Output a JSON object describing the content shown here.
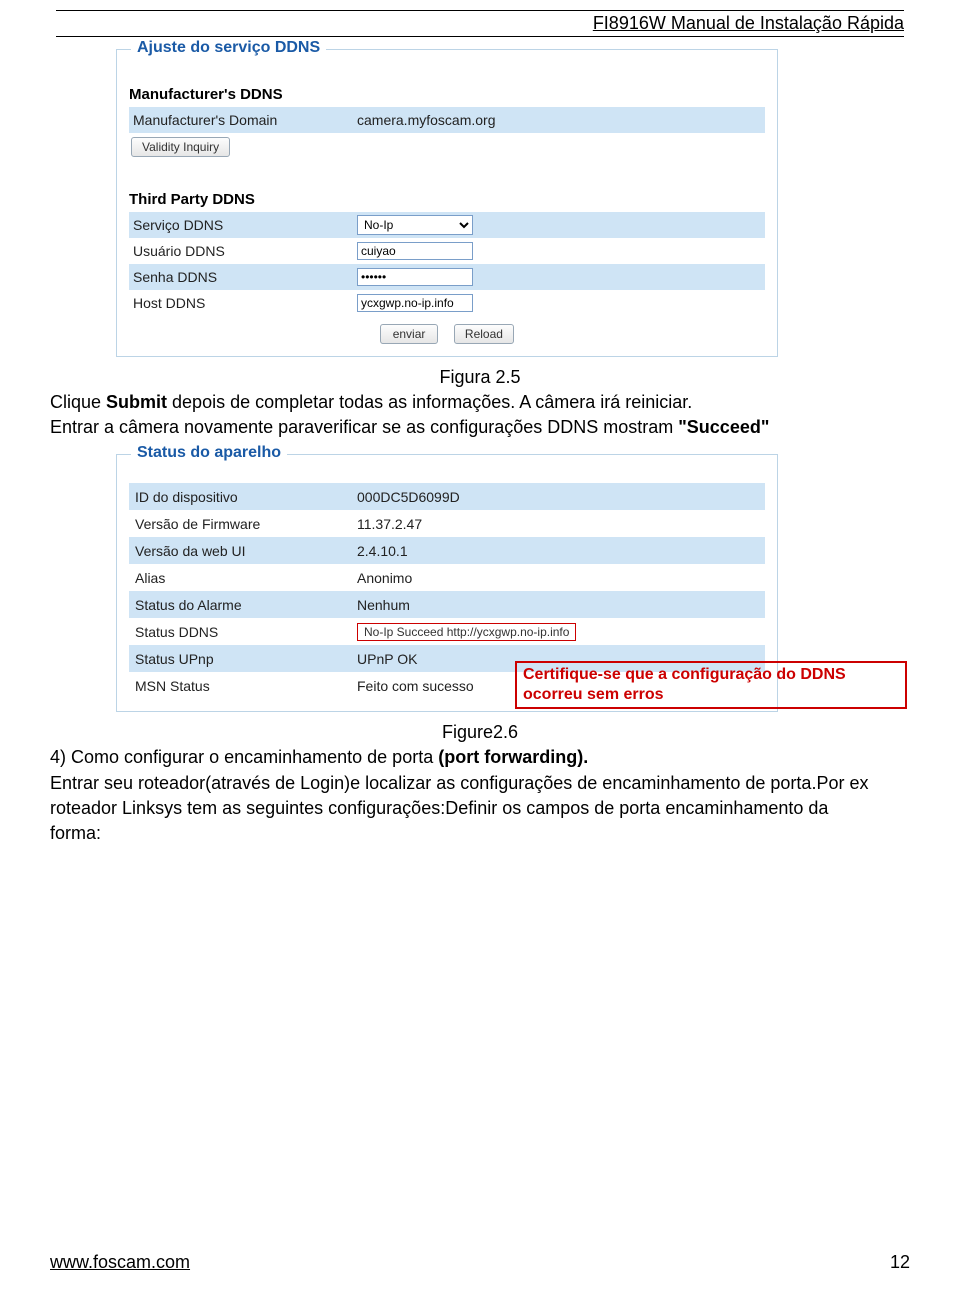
{
  "header": {
    "title": "FI8916W Manual de Instalação Rápida"
  },
  "panel1": {
    "title": "Ajuste do serviço DDNS",
    "manu_head": "Manufacturer's DDNS",
    "manu_domain_label": "Manufacturer's Domain",
    "manu_domain_value": "camera.myfoscam.org",
    "validity_btn": "Validity Inquiry",
    "third_head": "Third Party DDNS",
    "rows": {
      "servico_label": "Serviço DDNS",
      "servico_value": "No-Ip",
      "usuario_label": "Usuário DDNS",
      "usuario_value": "cuiyao",
      "senha_label": "Senha DDNS",
      "senha_value": "••••••",
      "host_label": "Host DDNS",
      "host_value": "ycxgwp.no-ip.info"
    },
    "buttons": {
      "enviar": "enviar",
      "reload": "Reload"
    }
  },
  "fig25": "Figura 2.5",
  "para1_a": "Clique ",
  "para1_b": "Submit",
  "para1_c": " depois de completar todas as informações. A câmera irá reiniciar.",
  "para2_a": "Entrar a câmera novamente paraverificar se as configurações DDNS mostram ",
  "para2_b": "\"Succeed\"",
  "panel2": {
    "title": "Status do aparelho",
    "rows": [
      {
        "label": "ID do dispositivo",
        "value": "000DC5D6099D",
        "shade": true
      },
      {
        "label": "Versão de Firmware",
        "value": "11.37.2.47",
        "shade": false
      },
      {
        "label": "Versão da web UI",
        "value": "2.4.10.1",
        "shade": true
      },
      {
        "label": "Alias",
        "value": "Anonimo",
        "shade": false
      },
      {
        "label": "Status do Alarme",
        "value": "Nenhum",
        "shade": true
      },
      {
        "label": "Status DDNS",
        "value": "No-Ip Succeed  http://ycxgwp.no-ip.info",
        "shade": false,
        "redbox": true
      },
      {
        "label": "Status UPnp",
        "value": "UPnP OK",
        "shade": true
      },
      {
        "label": "MSN Status",
        "value": "Feito com sucesso",
        "shade": false
      }
    ],
    "callout": "Certifique-se que a configuração do DDNS ocorreu sem erros"
  },
  "fig26": "Figure2.6",
  "para3_a": "4) Como configurar o encaminhamento de porta ",
  "para3_b": "(port forwarding).",
  "para4": "Entrar seu roteador(através de Login)e localizar as configurações de encaminhamento de porta.Por ex",
  "para5": "roteador Linksys tem as seguintes configurações:Definir os campos de porta encaminhamento da ",
  "para6": "forma:",
  "footer": {
    "url": "www.foscam.com",
    "page": "12"
  }
}
